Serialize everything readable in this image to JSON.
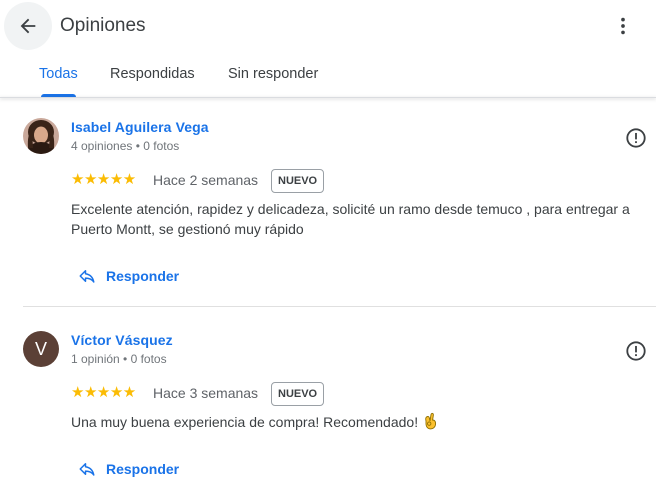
{
  "header": {
    "title": "Opiniones",
    "back_icon": "arrow-back-icon",
    "more_icon": "more-vert-icon"
  },
  "tabs": [
    {
      "label": "Todas",
      "active": true
    },
    {
      "label": "Respondidas",
      "active": false
    },
    {
      "label": "Sin responder",
      "active": false
    }
  ],
  "colors": {
    "accent": "#1a73e8",
    "star": "#fbbc04",
    "avatar_v": "#5b4036"
  },
  "reviews": [
    {
      "author": "Isabel Aguilera Vega",
      "meta": "4 opiniones • 0 fotos",
      "stars": "★★★★★",
      "rating": 5,
      "time": "Hace 2 semanas",
      "badge": "NUEVO",
      "text": "Excelente atención, rapidez y delicadeza, solicité un ramo desde temuco , para entregar a Puerto Montt, se gestionó muy rápido",
      "reply_label": "Responder"
    },
    {
      "author": "Víctor Vásquez",
      "avatar_letter": "V",
      "meta": "1 opinión • 0 fotos",
      "stars": "★★★★★",
      "rating": 5,
      "time": "Hace 3 semanas",
      "badge": "NUEVO",
      "text": "Una muy buena experiencia de compra! Recomendado!",
      "reply_label": "Responder"
    }
  ]
}
